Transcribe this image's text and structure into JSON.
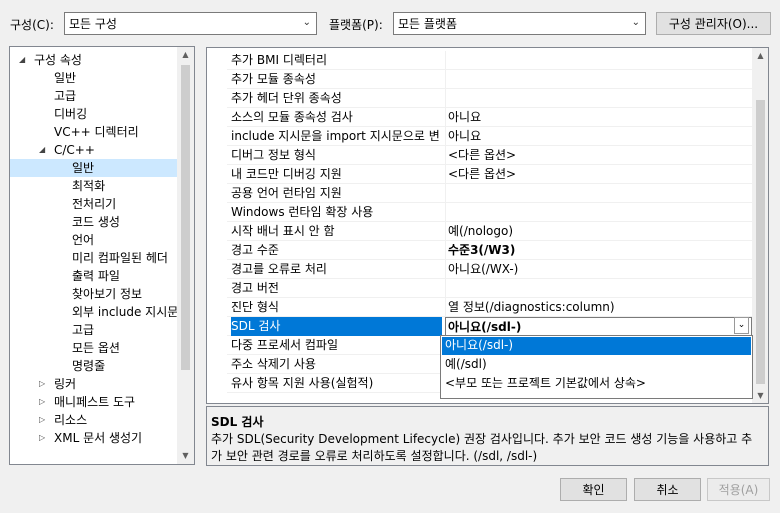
{
  "toolbar": {
    "config_label": "구성(C):",
    "config_value": "모든 구성",
    "platform_label": "플랫폼(P):",
    "platform_value": "모든 플랫폼",
    "config_manager_label": "구성 관리자(O)..."
  },
  "tree": {
    "items": [
      {
        "label": "구성 속성",
        "expanded": true
      },
      {
        "label": "일반"
      },
      {
        "label": "고급"
      },
      {
        "label": "디버깅"
      },
      {
        "label": "VC++ 디렉터리"
      },
      {
        "label": "C/C++",
        "expanded": true
      },
      {
        "label": "일반",
        "selected": true
      },
      {
        "label": "최적화"
      },
      {
        "label": "전처리기"
      },
      {
        "label": "코드 생성"
      },
      {
        "label": "언어"
      },
      {
        "label": "미리 컴파일된 헤더"
      },
      {
        "label": "출력 파일"
      },
      {
        "label": "찾아보기 정보"
      },
      {
        "label": "외부 include 지시문"
      },
      {
        "label": "고급"
      },
      {
        "label": "모든 옵션"
      },
      {
        "label": "명령줄"
      },
      {
        "label": "링커",
        "expanded": false
      },
      {
        "label": "매니페스트 도구",
        "expanded": false
      },
      {
        "label": "리소스",
        "expanded": false
      },
      {
        "label": "XML 문서 생성기",
        "expanded": false
      }
    ]
  },
  "grid": {
    "rows": [
      {
        "name": "추가 BMI 디렉터리",
        "value": ""
      },
      {
        "name": "추가 모듈 종속성",
        "value": ""
      },
      {
        "name": "추가 헤더 단위 종속성",
        "value": ""
      },
      {
        "name": "소스의 모듈 종속성 검사",
        "value": "아니요"
      },
      {
        "name": "include 지시문을 import 지시문으로 변",
        "value": "아니요"
      },
      {
        "name": "디버그 정보 형식",
        "value": "<다른 옵션>"
      },
      {
        "name": "내 코드만 디버깅 지원",
        "value": "<다른 옵션>"
      },
      {
        "name": "공용 언어 런타임 지원",
        "value": ""
      },
      {
        "name": "Windows 런타임 확장 사용",
        "value": ""
      },
      {
        "name": "시작 배너 표시 안 함",
        "value": "예(/nologo)"
      },
      {
        "name": "경고 수준",
        "value": "수준3(/W3)",
        "bold": true
      },
      {
        "name": "경고를 오류로 처리",
        "value": "아니요(/WX-)"
      },
      {
        "name": "경고 버전",
        "value": ""
      },
      {
        "name": "진단 형식",
        "value": "열 정보(/diagnostics:column)"
      },
      {
        "name": "SDL 검사",
        "value": "아니요(/sdl-)",
        "bold": true,
        "selected": true
      },
      {
        "name": "다중 프로세서 컴파일",
        "value": ""
      },
      {
        "name": "주소 삭제기 사용",
        "value": ""
      },
      {
        "name": "유사 항목 지원 사용(실험적)",
        "value": ""
      }
    ],
    "dropdown_options": [
      "아니요(/sdl-)",
      "예(/sdl)",
      "<부모 또는 프로젝트 기본값에서 상속>"
    ]
  },
  "description": {
    "title": "SDL 검사",
    "text": "추가 SDL(Security Development Lifecycle) 권장 검사입니다. 추가 보안 코드 생성 기능을 사용하고 추가 보안 관련 경로를 오류로 처리하도록 설정합니다. (/sdl, /sdl-)"
  },
  "buttons": {
    "ok": "확인",
    "cancel": "취소",
    "apply": "적용(A)"
  },
  "colors": {
    "accent": "#0078d7",
    "tree_selection": "#cce8ff"
  }
}
